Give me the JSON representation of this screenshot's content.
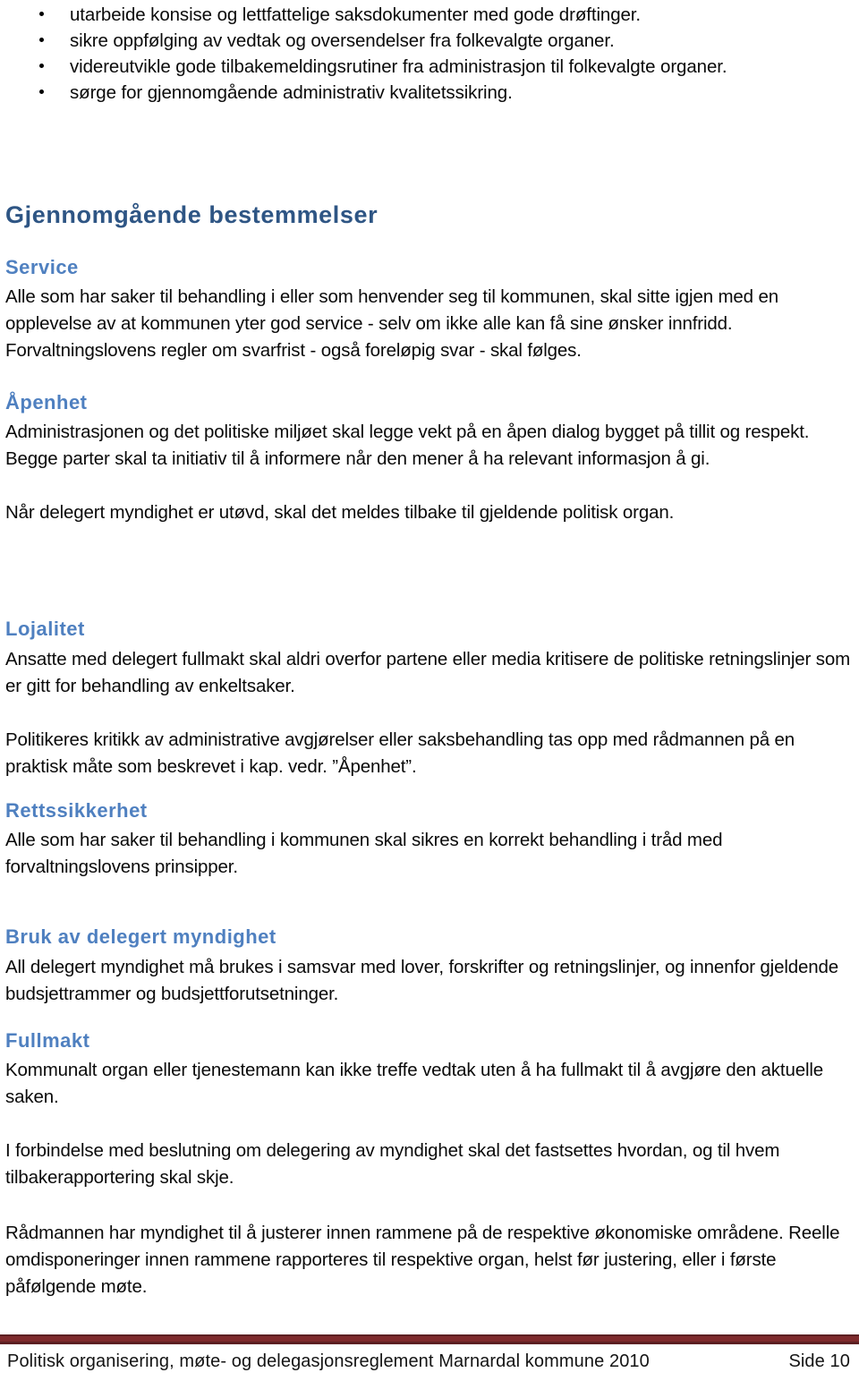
{
  "document": {
    "bullets": [
      "utarbeide konsise og lettfattelige saksdokumenter med gode drøftinger.",
      "sikre oppfølging av vedtak og oversendelser fra folkevalgte organer.",
      "videreutvikle gode tilbakemeldingsrutiner fra administrasjon til folkevalgte organer.",
      "sørge for gjennomgående administrativ kvalitetssikring."
    ],
    "main_heading": "Gjennomgående bestemmelser",
    "sections": [
      {
        "heading": "Service",
        "paragraphs": [
          "Alle som har saker til behandling i eller som henvender seg til kommunen, skal sitte igjen med en opplevelse av at kommunen yter god service - selv om ikke alle kan få sine ønsker innfridd. Forvaltningslovens regler om svarfrist - også foreløpig svar - skal følges."
        ]
      },
      {
        "heading": "Åpenhet",
        "paragraphs": [
          "Administrasjonen og det politiske miljøet skal legge vekt på en åpen dialog bygget på tillit og respekt.  Begge parter skal ta initiativ til å informere når den mener å ha relevant informasjon å gi.",
          "Når delegert myndighet er utøvd, skal det meldes tilbake til gjeldende politisk organ."
        ]
      },
      {
        "heading": "Lojalitet",
        "paragraphs": [
          "Ansatte med delegert fullmakt skal aldri overfor partene eller media kritisere de politiske retningslinjer som er gitt for behandling av enkeltsaker.",
          "Politikeres kritikk av administrative avgjørelser eller saksbehandling tas opp med rådmannen på en praktisk måte som beskrevet i kap. vedr. ”Åpenhet”."
        ]
      },
      {
        "heading": "Rettssikkerhet",
        "paragraphs": [
          "Alle som har saker til behandling i kommunen skal sikres en korrekt behandling i tråd med forvaltningslovens prinsipper."
        ]
      },
      {
        "heading": "Bruk av delegert myndighet",
        "paragraphs": [
          "All delegert myndighet må brukes i samsvar med lover, forskrifter og retningslinjer, og innenfor gjeldende budsjettrammer og budsjettforutsetninger."
        ]
      },
      {
        "heading": "Fullmakt",
        "paragraphs": [
          "Kommunalt organ eller tjenestemann kan ikke treffe vedtak uten å ha fullmakt til å avgjøre den aktuelle saken.",
          "I forbindelse med beslutning om delegering av myndighet skal det fastsettes hvordan, og til hvem tilbakerapportering skal skje.",
          "Rådmannen har myndighet til å justerer innen rammene på de respektive økonomiske områdene. Reelle omdisponeringer innen rammene rapporteres til respektive organ, helst før justering, eller i første påfølgende møte."
        ]
      }
    ],
    "footer": {
      "left": "Politisk organisering, møte- og delegasjonsreglement Marnardal kommune 2010",
      "right": "Side 10",
      "rule_color": "#5c1f22"
    }
  }
}
